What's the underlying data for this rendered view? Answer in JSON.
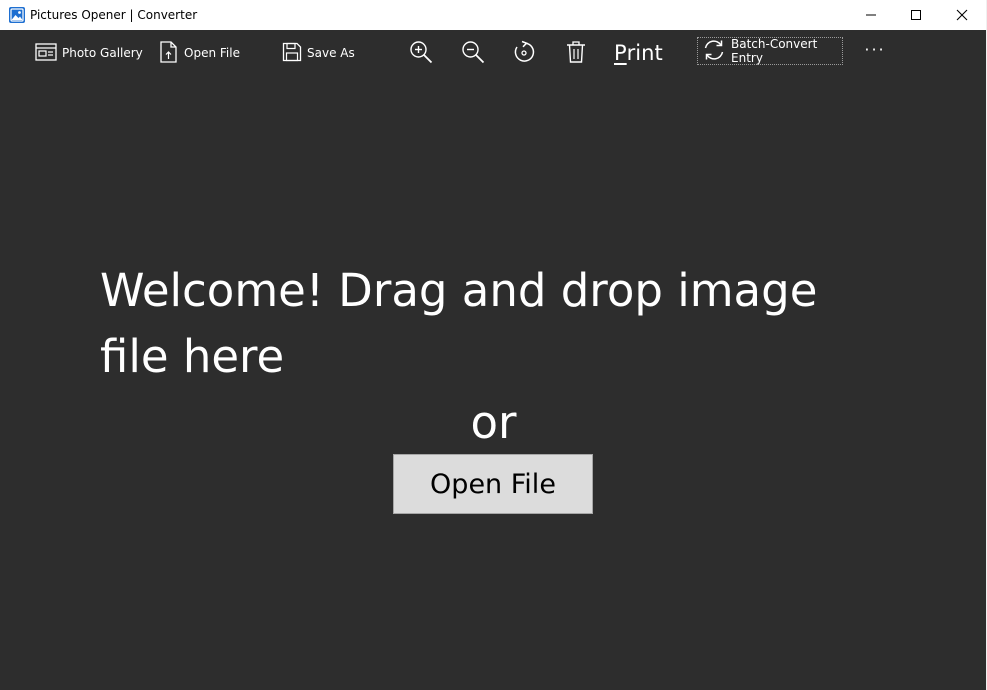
{
  "window": {
    "title": "Pictures Opener | Converter",
    "icon": "app-picture-icon"
  },
  "toolbar": {
    "gallery_label": "Photo Gallery",
    "open_label": "Open File",
    "save_label": "Save As",
    "zoom_in_icon": "zoom-in-icon",
    "zoom_out_icon": "zoom-out-icon",
    "rotate_icon": "rotate-icon",
    "delete_icon": "trash-icon",
    "print_first": "P",
    "print_rest": "rint",
    "batch_label": "Batch-Convert Entry",
    "more_label": "···"
  },
  "main": {
    "welcome_text": "Welcome! Drag and drop image file here",
    "or_text": "or",
    "open_button_label": "Open File"
  },
  "colors": {
    "background": "#2d2d2d",
    "titlebar": "#ffffff",
    "button_bg": "#dcdcdc",
    "icon_accent": "#1e6fd1"
  }
}
